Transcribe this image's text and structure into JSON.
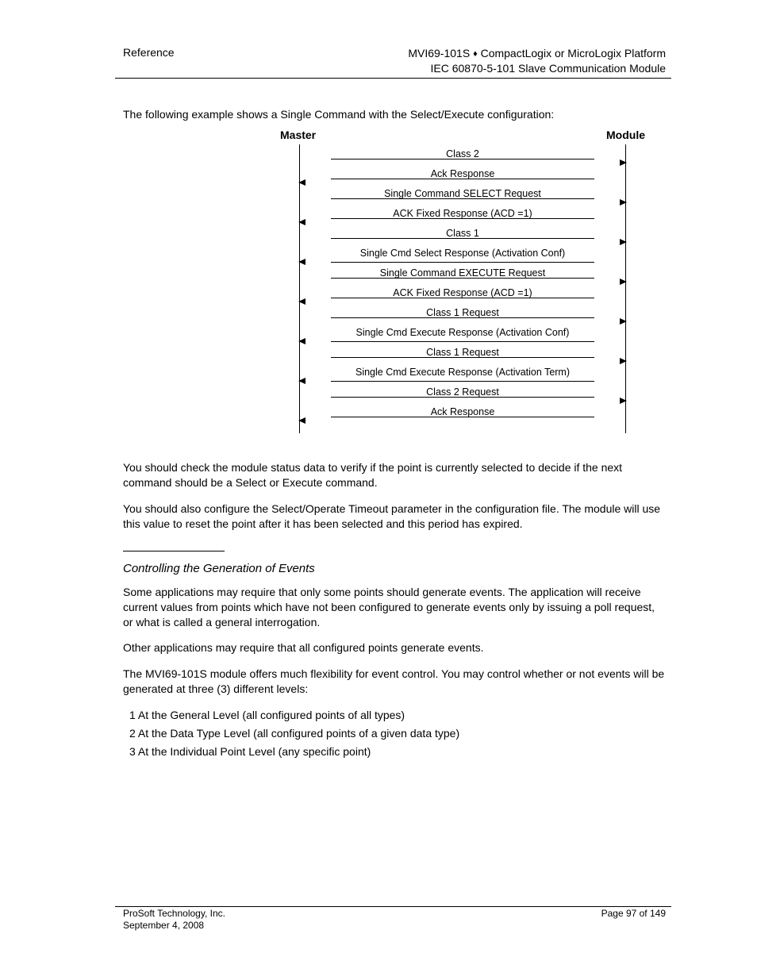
{
  "header": {
    "left": "Reference",
    "right_line1_prefix": "MVI69-101S ",
    "right_line1_suffix": " CompactLogix or MicroLogix Platform",
    "right_line2": "IEC 60870-5-101 Slave Communication Module"
  },
  "diagram": {
    "intro": "The following example shows a Single Command with the Select/Execute configuration:",
    "left_label": "Master",
    "right_label": "Module",
    "messages": [
      {
        "text": "Class 2",
        "dir": "right",
        "style": "short"
      },
      {
        "text": "Ack Response",
        "dir": "left",
        "style": "short"
      },
      {
        "text": "Single Command SELECT Request",
        "dir": "right",
        "style": "short"
      },
      {
        "text": "ACK Fixed Response (ACD =1)",
        "dir": "left",
        "style": "short"
      },
      {
        "text": "Class 1",
        "dir": "right",
        "style": "short"
      },
      {
        "text": "Single Cmd Select Response (Activation Conf)",
        "dir": "left",
        "style": "full"
      },
      {
        "text": "Single Command EXECUTE Request",
        "dir": "right",
        "style": "short"
      },
      {
        "text": "ACK Fixed Response (ACD =1)",
        "dir": "left",
        "style": "short"
      },
      {
        "text": "Class 1 Request",
        "dir": "right",
        "style": "short"
      },
      {
        "text": "Single Cmd Execute Response (Activation Conf)",
        "dir": "left",
        "style": "full"
      },
      {
        "text": "Class 1 Request",
        "dir": "right",
        "style": "short"
      },
      {
        "text": "Single Cmd Execute Response (Activation Term)",
        "dir": "left",
        "style": "full"
      },
      {
        "text": "Class 2  Request",
        "dir": "right",
        "style": "short"
      },
      {
        "text": "Ack Response",
        "dir": "left",
        "style": "short"
      }
    ]
  },
  "body": {
    "p1": "You should check the module status data to verify if the point is currently selected to decide if the next command should be a Select or Execute command.",
    "p2": "You should also configure the Select/Operate Timeout parameter in the configuration file. The module will use this value to reset the point after it has been selected and this period has expired.",
    "heading": "Controlling the Generation of Events",
    "p3": "Some applications may require that only some points should generate events. The application will receive current values from points which have not been configured to generate events only by issuing a poll request, or what is called a general interrogation.",
    "p4": "Other applications may require that all configured points generate events.",
    "p5": "The MVI69-101S module offers much flexibility for event control. You may control whether or not events will be generated at three (3) different levels:",
    "l1": "1  At the General Level (all configured points of all types)",
    "l2": "2  At the Data Type Level (all configured points of a given data type)",
    "l3": "3  At the Individual Point Level (any specific point)"
  },
  "footer": {
    "left_line1": "ProSoft Technology, Inc.",
    "left_line2": "September 4, 2008",
    "right_line1": "Page 97 of 149"
  }
}
